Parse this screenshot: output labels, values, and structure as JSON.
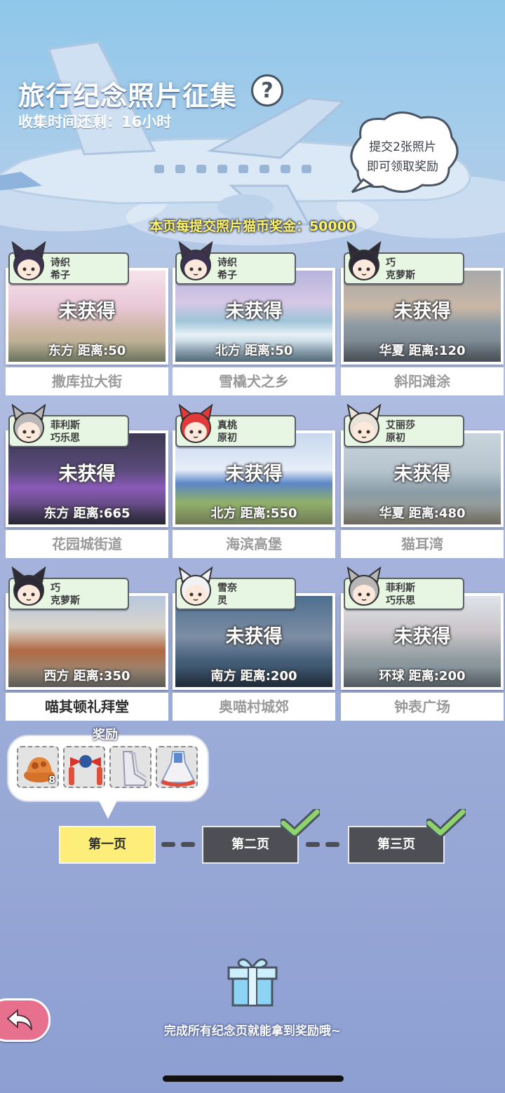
{
  "header": {
    "title": "旅行纪念照片征集",
    "help_icon": "question-icon",
    "timer": "收集时间还剩：16小时",
    "bubble_line1": "提交2张照片",
    "bubble_line2": "即可领取奖励",
    "bonus": "本页每提交照片猫币奖金：50000"
  },
  "cards": [
    {
      "name1": "诗织",
      "name2": "希子",
      "status": "未获得",
      "loc": "东方  距离:50",
      "place": "撒库拉大街"
    },
    {
      "name1": "诗织",
      "name2": "希子",
      "status": "未获得",
      "loc": "北方  距离:50",
      "place": "雪橇犬之乡"
    },
    {
      "name1": "巧",
      "name2": "克萝斯",
      "status": "未获得",
      "loc": "华夏  距离:120",
      "place": "斜阳滩涂"
    },
    {
      "name1": "菲利斯",
      "name2": "巧乐思",
      "status": "未获得",
      "loc": "东方  距离:665",
      "place": "花园城街道"
    },
    {
      "name1": "真桃",
      "name2": "原初",
      "status": "未获得",
      "loc": "北方  距离:550",
      "place": "海滨高堡"
    },
    {
      "name1": "艾丽莎",
      "name2": "原初",
      "status": "未获得",
      "loc": "华夏  距离:480",
      "place": "猫耳湾"
    },
    {
      "name1": "巧",
      "name2": "克萝斯",
      "status": "",
      "loc": "西方  距离:350",
      "place": "喵其顿礼拜堂"
    },
    {
      "name1": "雪奈",
      "name2": "灵",
      "status": "未获得",
      "loc": "南方  距离:200",
      "place": "奥喵村城郊"
    },
    {
      "name1": "菲利斯",
      "name2": "巧乐思",
      "status": "未获得",
      "loc": "环球  距离:200",
      "place": "钟表广场"
    }
  ],
  "reward": {
    "label": "奖励",
    "items": [
      {
        "icon": "food-plate-icon",
        "count": "8"
      },
      {
        "icon": "ribbon-bow-icon",
        "count": ""
      },
      {
        "icon": "boots-icon",
        "count": ""
      },
      {
        "icon": "dress-icon",
        "count": ""
      }
    ]
  },
  "pages": [
    {
      "label": "第一页",
      "state": "active"
    },
    {
      "label": "第二页",
      "state": "done"
    },
    {
      "label": "第三页",
      "state": "done"
    }
  ],
  "footer": {
    "tip": "完成所有纪念页就能拿到奖励哦~"
  },
  "colors": {
    "active_page": "#fdee7a",
    "done_page": "#4d4f55",
    "check": "#8fd46a",
    "bonus_text": "#fff36a",
    "back_button": "#e8708f"
  }
}
